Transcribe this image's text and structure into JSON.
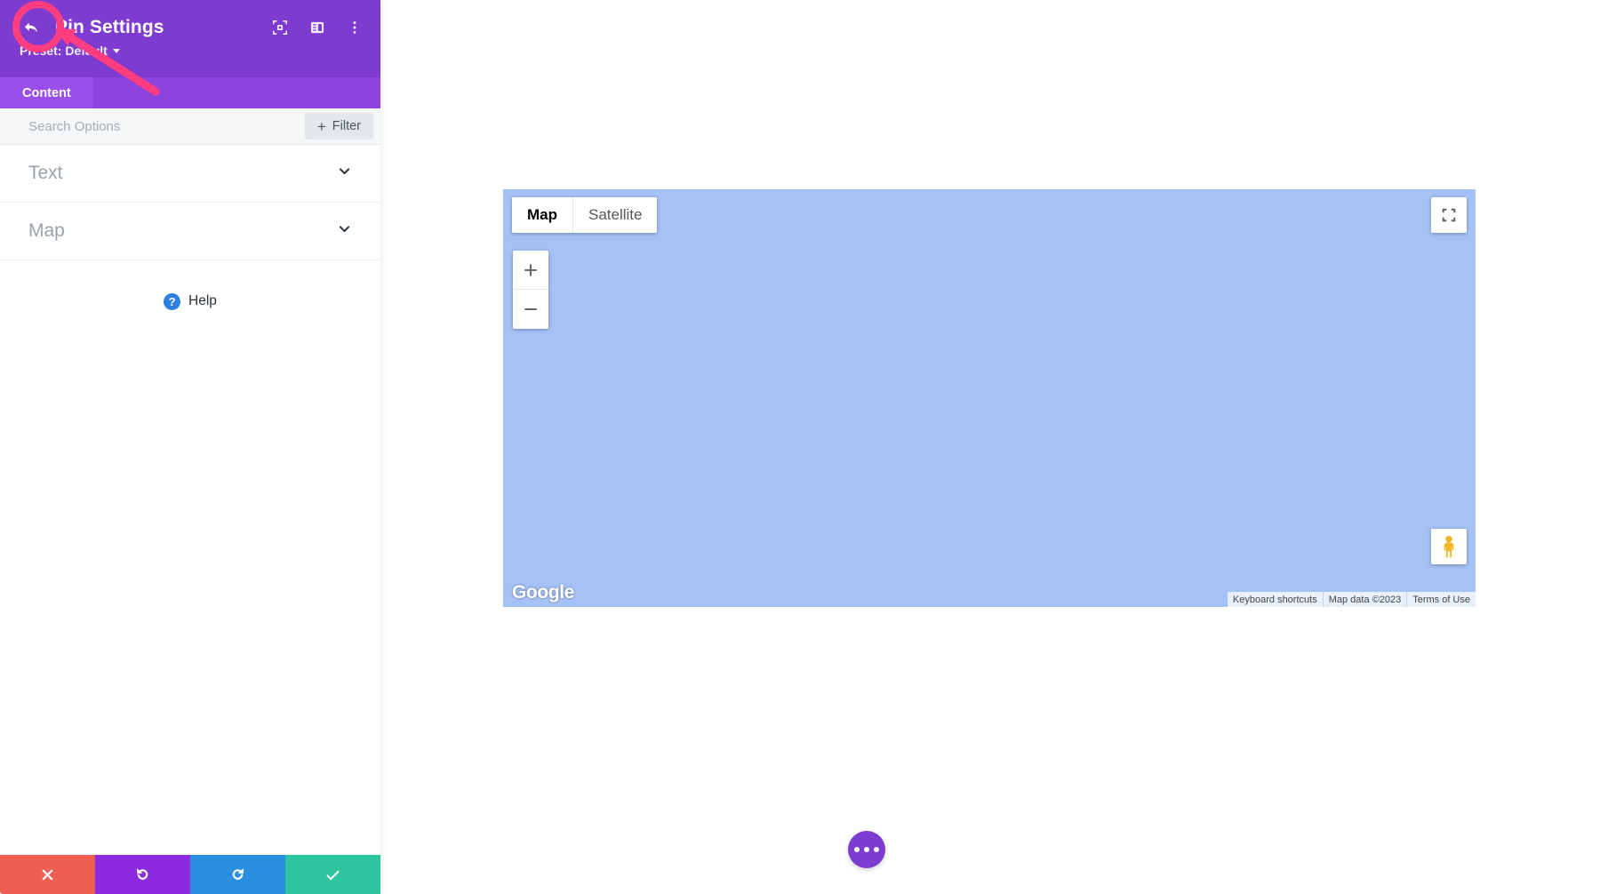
{
  "panel": {
    "header": {
      "title": "Pin Settings",
      "preset_label": "Preset: Default",
      "back_icon": "back-arrow-icon",
      "icons": [
        {
          "name": "focus-target-icon"
        },
        {
          "name": "layout-sidebar-icon"
        },
        {
          "name": "more-vertical-icon"
        }
      ],
      "background_color": "#7E3BD0"
    },
    "tabs": [
      {
        "label": "Content",
        "active": true
      }
    ],
    "search": {
      "placeholder": "Search Options",
      "value": "",
      "filter_label": "Filter",
      "filter_plus": "+"
    },
    "sections": [
      {
        "label": "Text",
        "expanded": false,
        "chevron": "chevron-down-icon"
      },
      {
        "label": "Map",
        "expanded": false,
        "chevron": "chevron-down-icon"
      }
    ],
    "help": {
      "label": "Help",
      "icon_glyph": "?",
      "icon_color": "#2D7FE0"
    },
    "actions": [
      {
        "name": "cancel",
        "icon": "close-x-icon",
        "color": "#EE5E52"
      },
      {
        "name": "undo",
        "icon": "undo-icon",
        "color": "#8C2BE0"
      },
      {
        "name": "redo",
        "icon": "redo-icon",
        "color": "#2B8FE0"
      },
      {
        "name": "save",
        "icon": "checkmark-icon",
        "color": "#2DC4A0"
      }
    ]
  },
  "annotation": {
    "highlight_color": "#FF3D7F",
    "target": "back-arrow-button",
    "shape": "circle-with-arrow"
  },
  "map": {
    "background_color": "#A5C1F5",
    "maptype_buttons": [
      {
        "label": "Map",
        "active": true
      },
      {
        "label": "Satellite",
        "active": false
      }
    ],
    "zoom_in_label": "+",
    "zoom_out_label": "−",
    "fullscreen_icon": "fullscreen-icon",
    "pegman_icon": "street-view-pegman-icon",
    "logo_text": "Google",
    "attribution": [
      "Keyboard shortcuts",
      "Map data ©2023",
      "Terms of Use"
    ]
  },
  "fab": {
    "icon": "more-horizontal-icon",
    "color": "#7E3BD0"
  }
}
